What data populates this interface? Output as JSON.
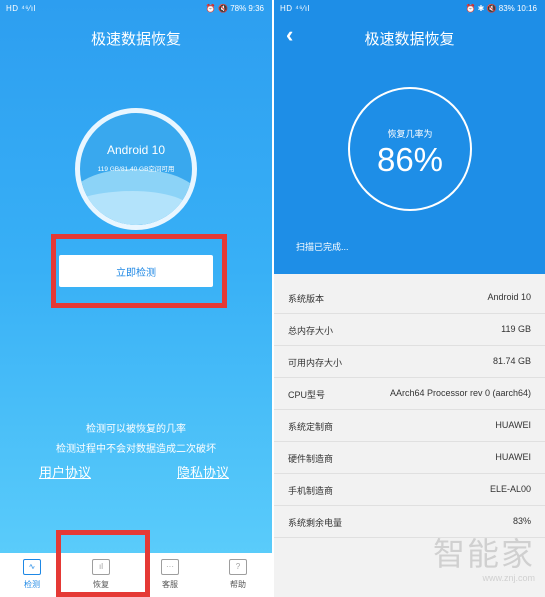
{
  "left": {
    "status": {
      "left": "HD ⁴⁶⁄ıl",
      "right": "⏰ 🔇 78% 9:36"
    },
    "title": "极速数据恢复",
    "gauge": {
      "os": "Android 10",
      "memory": "119 GB/81.40 GB空间可用"
    },
    "detect_button": "立即检测",
    "hint_line1": "检测可以被恢复的几率",
    "hint_line2": "检测过程中不会对数据造成二次破坏",
    "user_agreement": "用户协议",
    "privacy_policy": "隐私协议",
    "tabs": [
      {
        "label": "检测",
        "icon": "pulse-icon",
        "glyph": "∿"
      },
      {
        "label": "恢复",
        "icon": "bar-chart-icon",
        "glyph": "ıl"
      },
      {
        "label": "客服",
        "icon": "chat-icon",
        "glyph": "···"
      },
      {
        "label": "帮助",
        "icon": "help-icon",
        "glyph": "?"
      }
    ]
  },
  "right": {
    "status": {
      "left": "HD ⁴⁶⁄ıl",
      "right": "⏰ ✱ 🔇 83% 10:16"
    },
    "title": "极速数据恢复",
    "prob_label": "恢复几率为",
    "prob_value": "86%",
    "scan_status": "扫描已完成...",
    "rows": [
      {
        "key": "系统版本",
        "value": "Android 10"
      },
      {
        "key": "总内存大小",
        "value": "119 GB"
      },
      {
        "key": "可用内存大小",
        "value": "81.74 GB"
      },
      {
        "key": "CPU型号",
        "value": "AArch64 Processor rev 0 (aarch64)"
      },
      {
        "key": "系统定制商",
        "value": "HUAWEI"
      },
      {
        "key": "硬件制造商",
        "value": "HUAWEI"
      },
      {
        "key": "手机制造商",
        "value": "ELE-AL00"
      },
      {
        "key": "系统剩余电量",
        "value": "83%"
      }
    ],
    "watermark_logo": "智能家",
    "watermark_url": "www.znj.com"
  },
  "colors": {
    "accent": "#1e88e5",
    "highlight": "#e53935"
  }
}
